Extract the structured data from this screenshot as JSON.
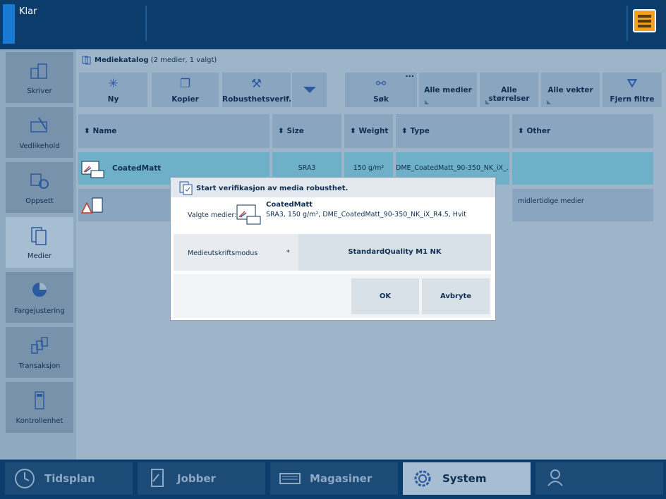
{
  "status": {
    "text": "Klar"
  },
  "nav": [
    {
      "label": "Skriver",
      "icon": "printer-icon"
    },
    {
      "label": "Vedlikehold",
      "icon": "maintenance-icon"
    },
    {
      "label": "Oppsett",
      "icon": "setup-icon"
    },
    {
      "label": "Medier",
      "icon": "media-icon",
      "active": true
    },
    {
      "label": "Fargejustering",
      "icon": "color-adjust-icon"
    },
    {
      "label": "Transaksjon",
      "icon": "transaction-icon"
    },
    {
      "label": "Kontrollenhet",
      "icon": "controller-icon"
    }
  ],
  "catalog": {
    "title": "Mediekatalog",
    "count": "(2 medier, 1 valgt)"
  },
  "toolbar": {
    "new": "Ny",
    "copy": "Kopier",
    "robust": "Robusthetsverif...",
    "search": "Søk",
    "more": "...",
    "all_media": "Alle medier",
    "all_sizes": "Alle størrelser",
    "all_weights": "Alle vekter",
    "remove_filters": "Fjern filtre"
  },
  "table": {
    "headers": [
      "Name",
      "Size",
      "Weight",
      "Type",
      "Other"
    ],
    "rows": [
      {
        "name": "CoatedMatt",
        "size": "SRA3",
        "weight": "150 g/m²",
        "type": "DME_CoatedMatt_90-350_NK_iX_...",
        "other": ""
      },
      {
        "name": "",
        "size": "",
        "weight": "",
        "type": "",
        "other": "midlertidige medier"
      }
    ]
  },
  "dialog": {
    "title": "Start verifikasjon av media robusthet.",
    "selected_label": "Valgte medier:",
    "media_name": "CoatedMatt",
    "media_desc": "SRA3, 150 g/m², DME_CoatedMatt_90-350_NK_iX_R4.5, Hvit",
    "mode_label": "Medieutskriftsmodus",
    "required_mark": "*",
    "mode_value": "StandardQuality M1 NK",
    "ok": "OK",
    "cancel": "Avbryte"
  },
  "tabs": [
    {
      "label": "Tidsplan",
      "icon": "clock-icon"
    },
    {
      "label": "Jobber",
      "icon": "jobs-icon"
    },
    {
      "label": "Magasiner",
      "icon": "trays-icon"
    },
    {
      "label": "System",
      "icon": "gear-icon",
      "active": true
    },
    {
      "label": "",
      "icon": "user-key-icon"
    }
  ],
  "colors": {
    "accent": "#f0a21e",
    "topbar": "#0b3c6c",
    "selected_row": "#6db0c8"
  }
}
